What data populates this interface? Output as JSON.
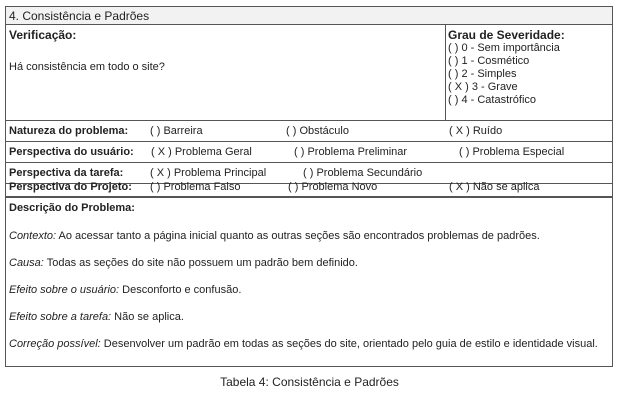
{
  "header": {
    "title": "4. Consistência e Padrões"
  },
  "verificacao": {
    "label": "Verificação:",
    "question": "Há consistência em todo o site?"
  },
  "severidade": {
    "label": "Grau de Severidade:",
    "items": [
      "( ) 0 - Sem importância",
      "( ) 1 - Cosmético",
      "( ) 2 - Simples",
      "( X ) 3 - Grave",
      "( ) 4 - Catastrófico"
    ]
  },
  "natureza": {
    "label": "Natureza do problema:",
    "options": [
      "( ) Barreira",
      "( ) Obstáculo",
      "( X ) Ruído"
    ]
  },
  "usuario": {
    "label": "Perspectiva do usuário:",
    "options": [
      "( X ) Problema Geral",
      "( ) Problema Preliminar",
      "( ) Problema Especial"
    ]
  },
  "tarefa": {
    "label": "Perspectiva da tarefa:",
    "options": [
      "( X ) Problema Principal",
      "( ) Problema Secundário"
    ]
  },
  "projeto": {
    "label": "Perspectiva do Projeto:",
    "options": [
      "( ) Problema Falso",
      "( ) Problema Novo",
      "( X ) Não se aplica"
    ]
  },
  "descricao": {
    "label": "Descrição do Problema:",
    "entries": [
      {
        "key": "Contexto:",
        "text": " Ao acessar tanto a página inicial quanto as outras seções são encontrados problemas de padrões."
      },
      {
        "key": "Causa:",
        "text": " Todas as seções do site não possuem um padrão bem definido."
      },
      {
        "key": "Efeito sobre o usuário:",
        "text": " Desconforto e confusão."
      },
      {
        "key": "Efeito sobre a tarefa:",
        "text": " Não se aplica."
      },
      {
        "key": "Correção possível:",
        "text": " Desenvolver um padrão em todas as seções do site, orientado pelo guia de estilo e identidade visual."
      }
    ]
  },
  "caption": "Tabela 4: Consistência e Padrões"
}
